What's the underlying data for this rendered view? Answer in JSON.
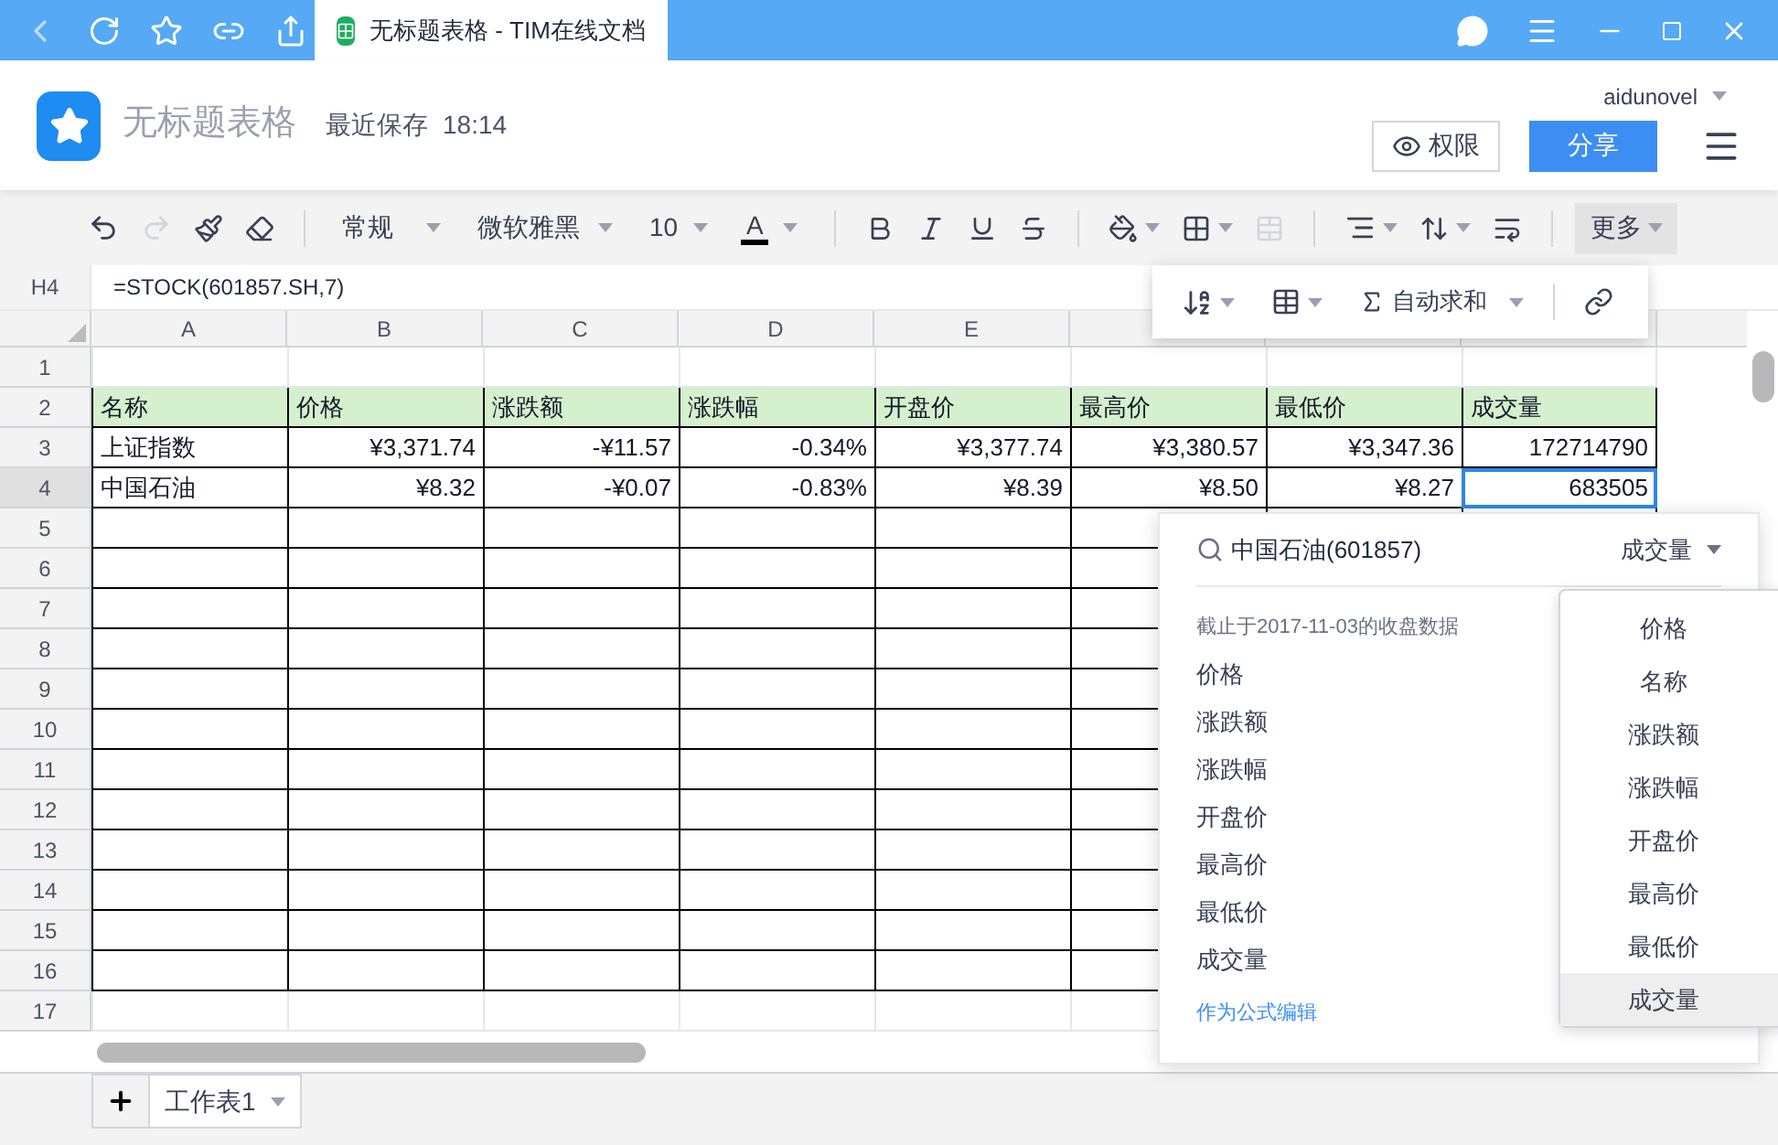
{
  "browser": {
    "tab_title": "无标题表格 - TIM在线文档"
  },
  "header": {
    "doc_title": "无标题表格",
    "save_label": "最近保存",
    "save_time": "18:14",
    "user": "aidunovel",
    "permission_button": "权限",
    "share_button": "分享"
  },
  "toolbar": {
    "style": "常规",
    "font": "微软雅黑",
    "size": "10",
    "font_color": "A",
    "more": "更多",
    "redo_disabled": true,
    "merge_disabled": true
  },
  "formula_bar": {
    "cell": "H4",
    "formula": "=STOCK(601857.SH,7)"
  },
  "more_menu": {
    "autosum": "自动求和"
  },
  "columns": [
    "A",
    "B",
    "C",
    "D",
    "E"
  ],
  "rows": [
    {
      "number": "1"
    },
    {
      "number": "2",
      "kind": "header",
      "cells": [
        {
          "text": "名称",
          "selected": false
        },
        {
          "text": "价格",
          "selected": false
        },
        {
          "text": "涨跌额",
          "selected": false
        },
        {
          "text": "涨跌幅",
          "selected": false
        },
        {
          "text": "开盘价",
          "selected": false
        },
        {
          "text": "最高价",
          "selected": false
        },
        {
          "text": "最低价",
          "selected": false
        },
        {
          "text": "成交量",
          "selected": false
        }
      ]
    },
    {
      "number": "3",
      "kind": "data",
      "cells": [
        {
          "text": "上证指数",
          "selected": false
        },
        {
          "text": "¥3,371.74",
          "selected": false
        },
        {
          "text": "-¥11.57",
          "selected": false
        },
        {
          "text": "-0.34%",
          "selected": false
        },
        {
          "text": "¥3,377.74",
          "selected": false
        },
        {
          "text": "¥3,380.57",
          "selected": false
        },
        {
          "text": "¥3,347.36",
          "selected": false
        },
        {
          "text": "172714790",
          "selected": false
        }
      ]
    },
    {
      "number": "4",
      "kind": "data",
      "cells": [
        {
          "text": "中国石油",
          "selected": false
        },
        {
          "text": "¥8.32",
          "selected": false
        },
        {
          "text": "-¥0.07",
          "selected": false
        },
        {
          "text": "-0.83%",
          "selected": false
        },
        {
          "text": "¥8.39",
          "selected": false
        },
        {
          "text": "¥8.50",
          "selected": false
        },
        {
          "text": "¥8.27",
          "selected": false
        },
        {
          "text": "683505",
          "selected": true
        }
      ]
    },
    {
      "number": "5"
    },
    {
      "number": "6"
    },
    {
      "number": "7"
    },
    {
      "number": "8"
    },
    {
      "number": "9"
    },
    {
      "number": "10"
    },
    {
      "number": "11"
    },
    {
      "number": "12"
    },
    {
      "number": "13"
    },
    {
      "number": "14"
    },
    {
      "number": "15"
    },
    {
      "number": "16"
    },
    {
      "number": "17"
    }
  ],
  "stock_panel": {
    "search": "中国石油(601857)",
    "field": "成交量",
    "note": "截止于2017-11-03的收盘数据",
    "fields": [
      "价格",
      "涨跌额",
      "涨跌幅",
      "开盘价",
      "最高价",
      "最低价",
      "成交量"
    ],
    "link": "作为公式编辑"
  },
  "field_dropdown": [
    {
      "label": "价格",
      "selected": false
    },
    {
      "label": "名称",
      "selected": false
    },
    {
      "label": "涨跌额",
      "selected": false
    },
    {
      "label": "涨跌幅",
      "selected": false
    },
    {
      "label": "开盘价",
      "selected": false
    },
    {
      "label": "最高价",
      "selected": false
    },
    {
      "label": "最低价",
      "selected": false
    },
    {
      "label": "成交量",
      "selected": true
    }
  ],
  "sheet_tabs": [
    {
      "label": "工作表1",
      "selected": true
    }
  ]
}
